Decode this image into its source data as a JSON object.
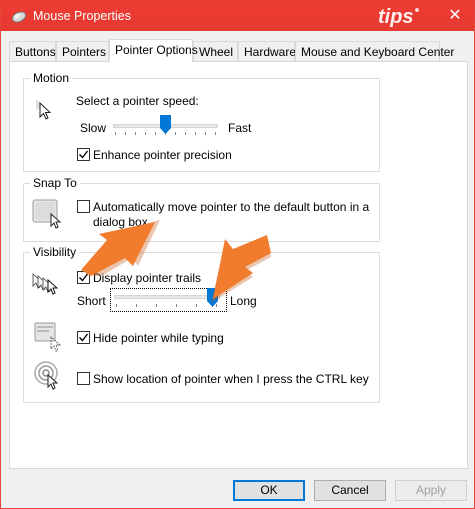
{
  "window": {
    "title": "Mouse Properties",
    "close_glyph": "✕",
    "logo_text": "tips"
  },
  "tabs": [
    {
      "label": "Buttons",
      "active": false
    },
    {
      "label": "Pointers",
      "active": false
    },
    {
      "label": "Pointer Options",
      "active": true
    },
    {
      "label": "Wheel",
      "active": false
    },
    {
      "label": "Hardware",
      "active": false
    },
    {
      "label": "Mouse and Keyboard Center",
      "active": false
    }
  ],
  "motion": {
    "title": "Motion",
    "speed_label": "Select a pointer speed:",
    "slow_label": "Slow",
    "fast_label": "Fast",
    "speed_value": 0.5,
    "enhance_label": "Enhance pointer precision",
    "enhance_checked": true
  },
  "snap_to": {
    "title": "Snap To",
    "auto_label_line1": "Automatically move pointer to the default button in a",
    "auto_label_line2": "dialog box",
    "auto_checked": false
  },
  "visibility": {
    "title": "Visibility",
    "trails_label": "Display pointer trails",
    "trails_checked": true,
    "short_label": "Short",
    "long_label": "Long",
    "trail_length_value": 1.0,
    "hide_label": "Hide pointer while typing",
    "hide_checked": true,
    "show_label": "Show location of pointer when I press the CTRL key",
    "show_checked": false
  },
  "buttons": {
    "ok": "OK",
    "cancel": "Cancel",
    "apply": "Apply"
  },
  "colors": {
    "titlebar": "#e53a31",
    "accent": "#0078d7",
    "annotation_arrow": "#f27c2e"
  }
}
